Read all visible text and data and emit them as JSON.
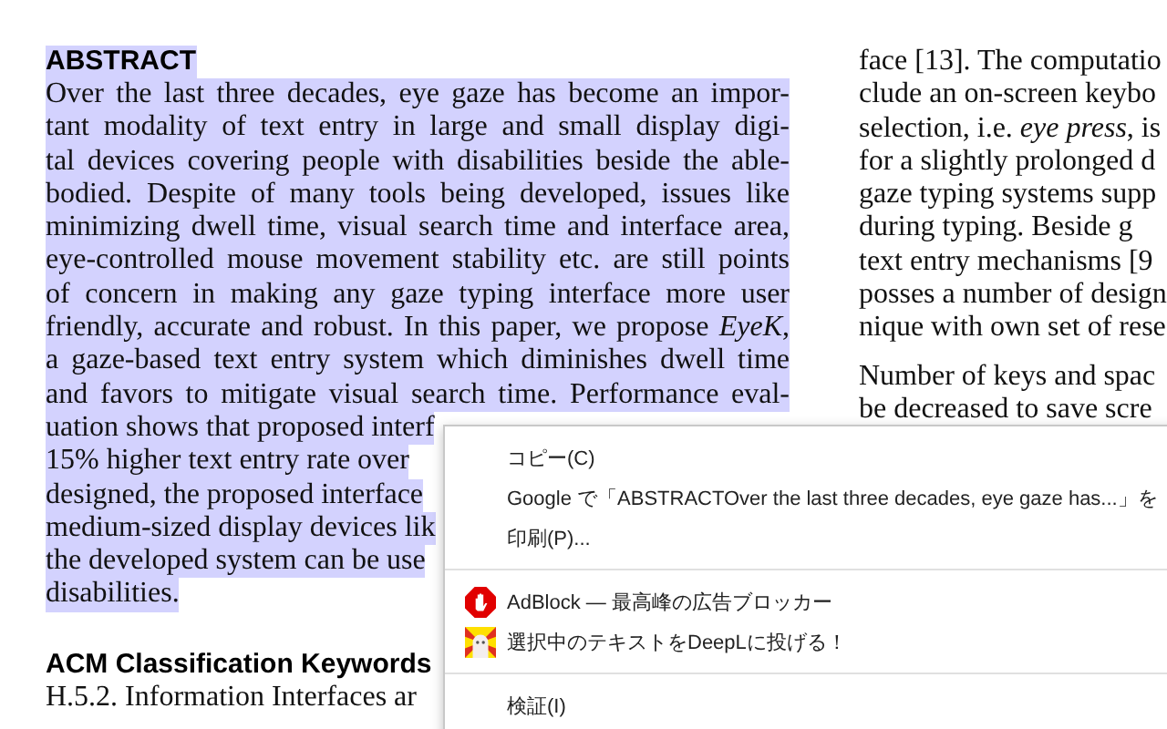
{
  "document": {
    "left_column": {
      "abstract": {
        "selected": true,
        "heading": "ABSTRACT",
        "lines": [
          {
            "text": "Over the last three decades, eye gaze has become an impor-",
            "kind": "full"
          },
          {
            "text": "tant modality of text entry in large and small display digi-",
            "kind": "full"
          },
          {
            "text": "tal devices covering people with disabilities beside the able-",
            "kind": "full"
          },
          {
            "text": "bodied.  Despite of many tools being developed, issues like",
            "kind": "full"
          },
          {
            "text": "minimizing dwell time, visual search time and interface area,",
            "kind": "full"
          },
          {
            "text": "eye-controlled mouse movement stability etc. are still points",
            "kind": "full"
          },
          {
            "text": "of concern in making any gaze typing interface more user",
            "kind": "full"
          },
          {
            "text": "friendly, accurate and robust. In this paper, we propose *EyeK*,",
            "kind": "full"
          },
          {
            "text": "a gaze-based text entry system which diminishes dwell time",
            "kind": "full"
          },
          {
            "text": "and favors to mitigate visual search time. Performance eval-",
            "kind": "full"
          },
          {
            "text": "uation shows that proposed interf",
            "kind": "cut"
          },
          {
            "text": "15% higher text entry rate over",
            "kind": "cut"
          },
          {
            "text": "designed, the proposed interface",
            "kind": "cut"
          },
          {
            "text": "medium-sized display devices lik",
            "kind": "cut"
          },
          {
            "text": "the developed system can be use",
            "kind": "cut"
          },
          {
            "text": "disabilities.",
            "kind": "last"
          }
        ]
      },
      "section": {
        "heading": "ACM Classification Keywords",
        "lines": [
          "H.5.2.  Information Interfaces ar"
        ]
      }
    },
    "right_column": {
      "paragraphs": [
        {
          "lines": [
            "face [13]. The computatio",
            "clude an on-screen keybo",
            "selection, i.e. *eye press*, is",
            "for a slightly prolonged d",
            "gaze typing systems supp",
            "during typing.  Beside g",
            "text entry mechanisms [9",
            "posses a number of design",
            "nique with own set of rese"
          ]
        },
        {
          "lines": [
            "Number of keys and spac",
            "be decreased to save scre"
          ]
        }
      ]
    }
  },
  "context_menu": {
    "groups": [
      {
        "items": [
          {
            "label": "コピー(C)",
            "kind": "command"
          },
          {
            "label": "Google で「ABSTRACTOver the last three decades, eye gaze has...」を",
            "kind": "command"
          },
          {
            "label": "印刷(P)...",
            "kind": "command"
          }
        ]
      },
      {
        "items": [
          {
            "label": "AdBlock — 最高峰の広告ブロッカー",
            "kind": "extension"
          },
          {
            "label": "選択中のテキストをDeepLに投げる！",
            "kind": "extension"
          }
        ]
      },
      {
        "items": [
          {
            "label": "検証(I)",
            "kind": "command"
          }
        ]
      }
    ]
  }
}
